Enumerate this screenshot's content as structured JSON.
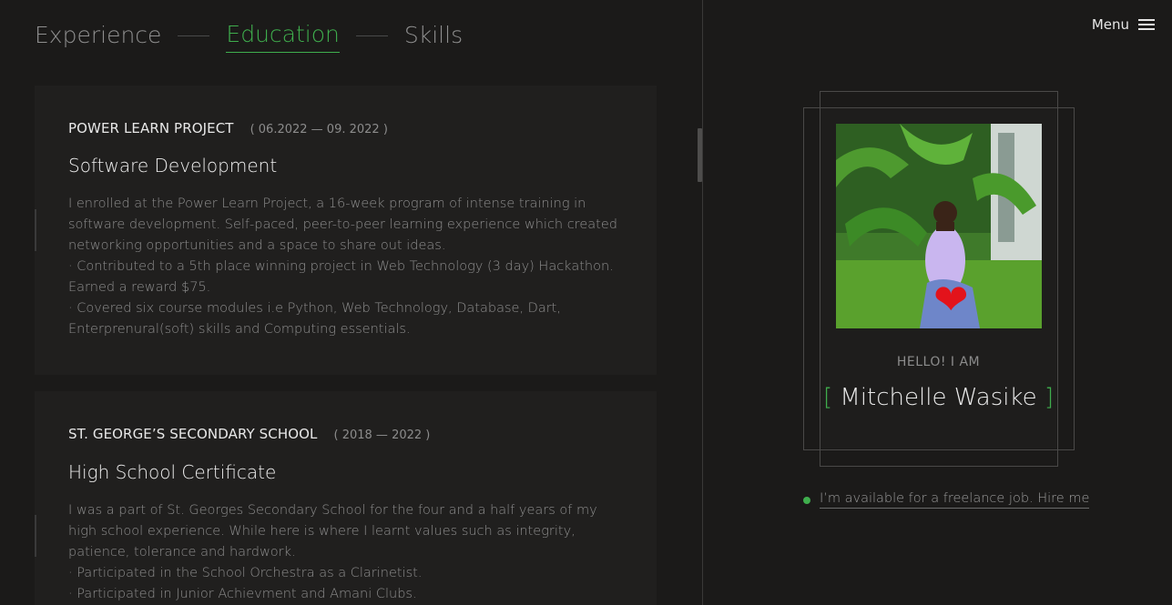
{
  "tabs": [
    "Experience",
    "Education",
    "Skills"
  ],
  "active_tab": "Education",
  "menu": {
    "label": "Menu"
  },
  "education": [
    {
      "institution": "POWER LEARN PROJECT",
      "period": "( 06.2022 — 09. 2022 )",
      "degree": "Software Development",
      "description": [
        "I enrolled at the Power Learn Project, a 16-week program of intense training in software development. Self-paced, peer-to-peer learning experience which created networking opportunities and a space to share out ideas.",
        "· Contributed to a 5th place winning project in Web Technology (3 day) Hackathon. Earned a reward $75.",
        "· Covered six course modules i.e Python, Web Technology, Database, Dart, Enterprenural(soft) skills and Computing essentials."
      ]
    },
    {
      "institution": "ST. GEORGE’S SECONDARY SCHOOL",
      "period": "( 2018 — 2022 )",
      "degree": "High School Certificate",
      "description": [
        "I was a part of St. Georges Secondary School for the four and a half years of my high school experience. While here is where I learnt values such as integrity, patience, tolerance and hardwork.",
        "· Participated in the School Orchestra as a Clarinetist.",
        "· Participated in Junior Achievment and Amani Clubs."
      ]
    }
  ],
  "profile": {
    "greeting": "HELLO! I AM",
    "bracket_open": "[",
    "name": "Mitchelle Wasike",
    "bracket_close": "]"
  },
  "availability": {
    "text": "I’m available for a freelance job. Hire me"
  },
  "colors": {
    "accent": "#3fae4d",
    "background": "#1b1a19",
    "card": "#201f1e"
  },
  "icons": [
    "hamburger-menu-icon",
    "heart-icon",
    "status-dot-icon"
  ]
}
